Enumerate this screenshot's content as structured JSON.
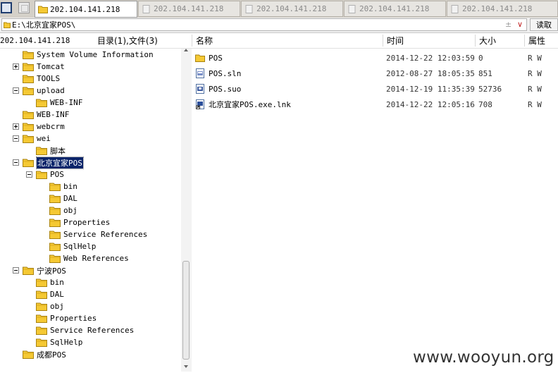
{
  "tabs": [
    {
      "label": "202.104.141.218",
      "active": true
    },
    {
      "label": "202.104.141.218",
      "active": false
    },
    {
      "label": "202.104.141.218",
      "active": false
    },
    {
      "label": "202.104.141.218",
      "active": false
    },
    {
      "label": "202.104.141.218",
      "active": false
    }
  ],
  "address": {
    "path": "E:\\北京宜家POS\\",
    "read_button": "读取",
    "add_glyph": "±",
    "dropdown_glyph": "∨"
  },
  "header": {
    "tree_root": "202.104.141.218",
    "summary": "目录(1),文件(3)",
    "columns": {
      "name": "名称",
      "time": "时间",
      "size": "大小",
      "attr": "属性"
    }
  },
  "tree": [
    {
      "label": "System Volume Information"
    },
    {
      "label": "Tomcat"
    },
    {
      "label": "TOOLS"
    },
    {
      "label": "upload"
    },
    {
      "label": "WEB-INF"
    },
    {
      "label": "WEB-INF"
    },
    {
      "label": "webcrm"
    },
    {
      "label": "wei"
    },
    {
      "label": "脚本"
    },
    {
      "label": "北京宜家POS"
    },
    {
      "label": "POS"
    },
    {
      "label": "bin"
    },
    {
      "label": "DAL"
    },
    {
      "label": "obj"
    },
    {
      "label": "Properties"
    },
    {
      "label": "Service References"
    },
    {
      "label": "SqlHelp"
    },
    {
      "label": "Web References"
    },
    {
      "label": "宁波POS"
    },
    {
      "label": "bin"
    },
    {
      "label": "DAL"
    },
    {
      "label": "obj"
    },
    {
      "label": "Properties"
    },
    {
      "label": "Service References"
    },
    {
      "label": "SqlHelp"
    },
    {
      "label": "成都POS"
    }
  ],
  "files": [
    {
      "name": "POS",
      "icon": "folder-icon",
      "time": "2014-12-22 12:03:59",
      "size": "0",
      "attr": "R W"
    },
    {
      "name": "POS.sln",
      "icon": "file-sln-icon",
      "time": "2012-08-27 18:05:35",
      "size": "851",
      "attr": "R W"
    },
    {
      "name": "POS.suo",
      "icon": "file-suo-icon",
      "time": "2014-12-19 11:35:39",
      "size": "52736",
      "attr": "R W"
    },
    {
      "name": "北京宜家POS.exe.lnk",
      "icon": "file-shortcut-icon",
      "time": "2014-12-22 12:05:16",
      "size": "708",
      "attr": "R W"
    }
  ],
  "watermark": "www.wooyun.org",
  "colors": {
    "folder": "#f5c934",
    "selection": "#0a246a",
    "chrome": "#d4d0c8"
  }
}
